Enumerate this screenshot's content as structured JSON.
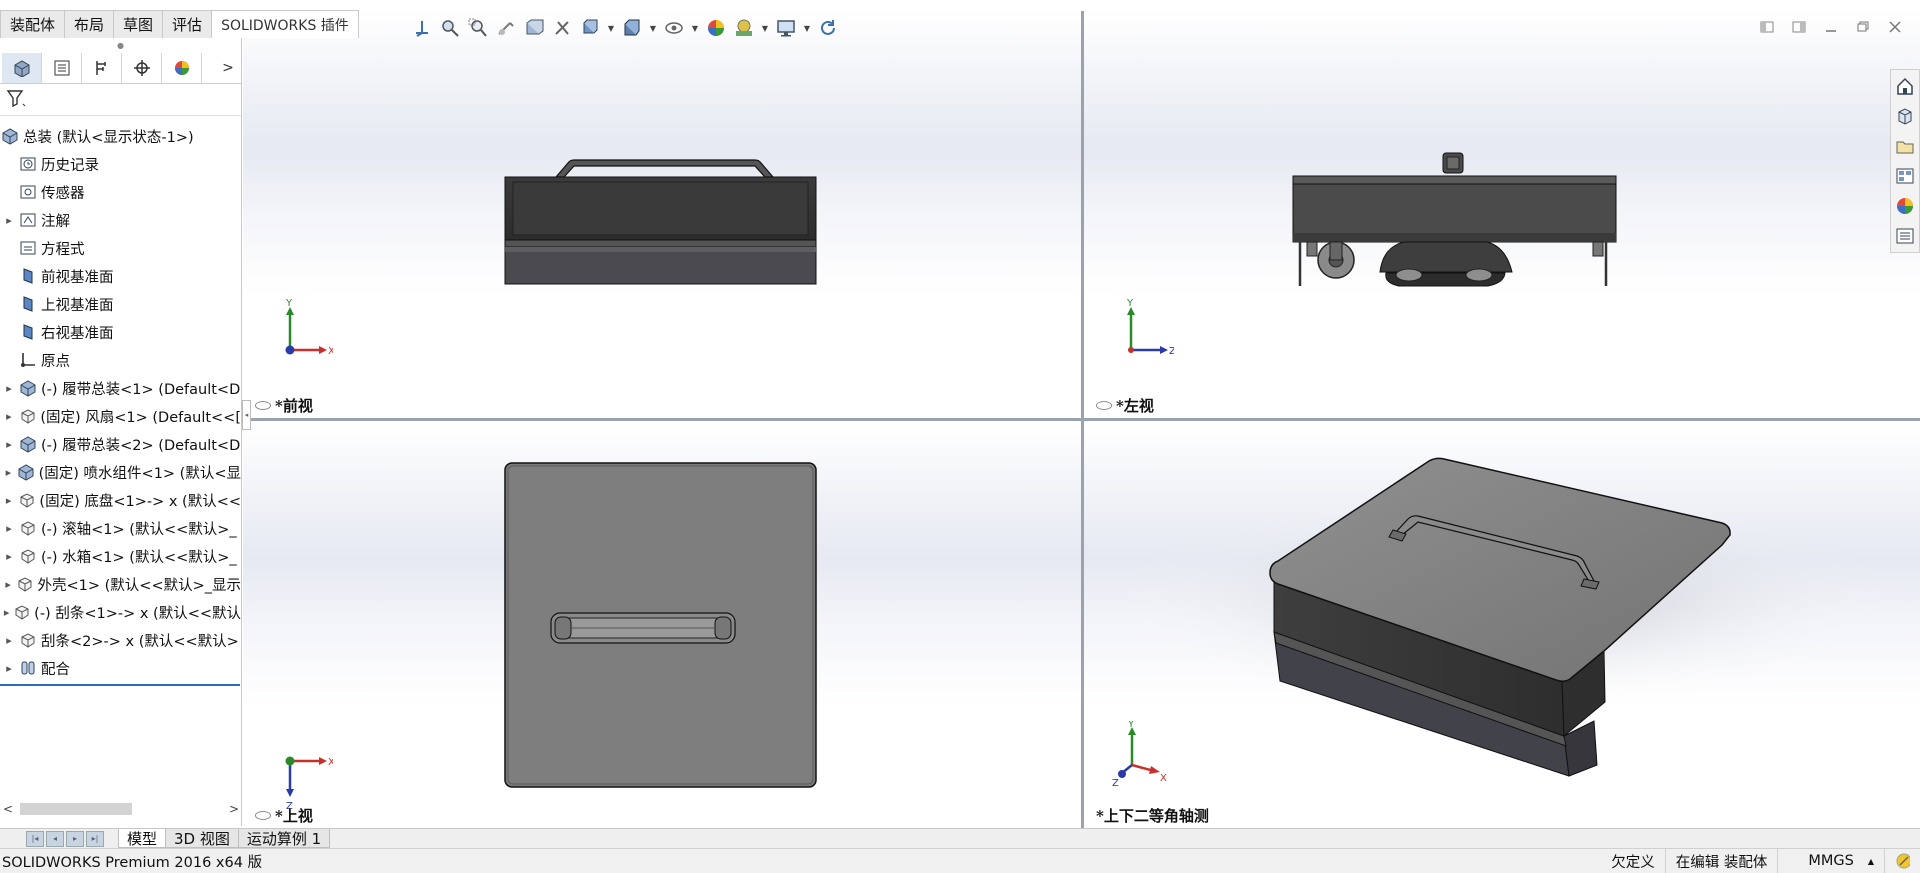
{
  "command_manager": {
    "tabs": [
      {
        "label": "装配体"
      },
      {
        "label": "布局"
      },
      {
        "label": "草图"
      },
      {
        "label": "评估"
      },
      {
        "label": "SOLIDWORKS 插件"
      }
    ]
  },
  "heads_up_toolbar": {
    "icons": [
      "view-orientation-icon",
      "zoom-to-fit-icon",
      "zoom-to-area-icon",
      "previous-view-icon",
      "section-view-icon",
      "dynamic-annotation-icon",
      "view-orientation-dropdown-icon",
      "display-style-icon",
      "hide-show-items-icon",
      "edit-appearance-icon",
      "apply-scene-icon",
      "view-settings-icon",
      "rebuild-icon"
    ]
  },
  "feature_manager": {
    "tabs": [
      "feature-manager-icon",
      "property-manager-icon",
      "configuration-manager-icon",
      "dimxpert-manager-icon",
      "display-manager-icon"
    ],
    "filter_icon": "filter-icon",
    "root": {
      "label": "总装 (默认<显示状态-1>)",
      "icon": "assembly-icon"
    },
    "items": [
      {
        "label": "历史记录",
        "icon": "history-icon",
        "expandable": false
      },
      {
        "label": "传感器",
        "icon": "sensor-icon",
        "expandable": false
      },
      {
        "label": "注解",
        "icon": "annotation-icon",
        "expandable": true
      },
      {
        "label": "方程式",
        "icon": "equation-icon",
        "expandable": false
      },
      {
        "label": "前视基准面",
        "icon": "plane-icon",
        "expandable": false
      },
      {
        "label": "上视基准面",
        "icon": "plane-icon",
        "expandable": false
      },
      {
        "label": "右视基准面",
        "icon": "plane-icon",
        "expandable": false
      },
      {
        "label": "原点",
        "icon": "origin-icon",
        "expandable": false
      },
      {
        "label": "(-) 履带总装<1> (Default<D",
        "icon": "subassembly-icon",
        "expandable": true
      },
      {
        "label": "(固定) 风扇<1> (Default<<[",
        "icon": "part-icon",
        "expandable": true
      },
      {
        "label": "(-) 履带总装<2> (Default<D",
        "icon": "subassembly-icon",
        "expandable": true
      },
      {
        "label": "(固定) 喷水组件<1> (默认<显",
        "icon": "subassembly-icon",
        "expandable": true
      },
      {
        "label": "(固定) 底盘<1>-> x (默认<<",
        "icon": "part-icon",
        "expandable": true
      },
      {
        "label": "(-) 滚轴<1> (默认<<默认>_",
        "icon": "part-icon",
        "expandable": true
      },
      {
        "label": "(-) 水箱<1> (默认<<默认>_",
        "icon": "part-icon",
        "expandable": true
      },
      {
        "label": "外壳<1> (默认<<默认>_显示",
        "icon": "part-icon",
        "expandable": true
      },
      {
        "label": "(-) 刮条<1>-> x (默认<<默认",
        "icon": "part-icon",
        "expandable": true
      },
      {
        "label": "刮条<2>-> x (默认<<默认>",
        "icon": "part-icon",
        "expandable": true
      },
      {
        "label": "配合",
        "icon": "mates-icon",
        "expandable": true
      }
    ]
  },
  "viewports": {
    "front": {
      "label": "*前视"
    },
    "left": {
      "label": "*左视"
    },
    "top": {
      "label": "*上视"
    },
    "iso": {
      "label": "*上下二等角轴测"
    }
  },
  "triad_labels": {
    "x": "X",
    "y": "Y",
    "z": "Z"
  },
  "window_controls": [
    "tile-left-icon",
    "tile-right-icon",
    "minimize-icon",
    "restore-icon",
    "close-icon"
  ],
  "task_pane": [
    "home-icon",
    "design-library-icon",
    "file-explorer-icon",
    "view-palette-icon",
    "appearances-icon",
    "custom-properties-icon"
  ],
  "bottom_tabs": [
    {
      "label": "模型"
    },
    {
      "label": "3D 视图"
    },
    {
      "label": "运动算例 1"
    }
  ],
  "status": {
    "app": "SOLIDWORKS Premium 2016 x64 版",
    "underdefined": "欠定义",
    "editing": "在编辑 装配体",
    "units": "MMGS",
    "units_arrow": "▲"
  }
}
